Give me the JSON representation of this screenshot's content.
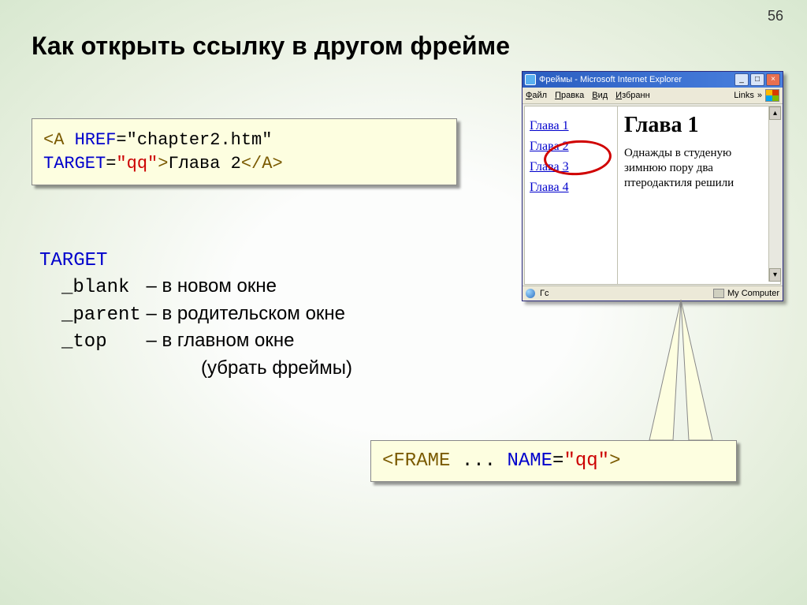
{
  "page_number": "56",
  "title": "Как открыть ссылку в другом фрейме",
  "code1": {
    "lt1": "<",
    "A": "A",
    "sp": " ",
    "HREF": "HREF",
    "eq": "=",
    "href_val": "\"chapter2.htm\"",
    "indent": "    ",
    "TARGET": "TARGET",
    "target_val": "\"qq\"",
    "gt": ">",
    "linktext": "Глава 2",
    "lt2": "</",
    "A2": "A",
    "gt2": ">"
  },
  "targets": {
    "head": "TARGET",
    "rows": [
      {
        "kw": "_blank ",
        "desc": " – в новом окне"
      },
      {
        "kw": "_parent",
        "desc": " – в родительском окне"
      },
      {
        "kw": "_top   ",
        "desc": " – в главном окне"
      }
    ],
    "extra": "(убрать фреймы)"
  },
  "code2": {
    "lt": "<",
    "FRAME": "FRAME",
    "dots": " ... ",
    "NAME": "NAME",
    "eq": "=",
    "name_val": "\"qq\"",
    "gt": ">"
  },
  "browser": {
    "title": "Фреймы - Microsoft Internet Explorer",
    "menu": {
      "file": "Файл",
      "edit": "Правка",
      "view": "Вид",
      "fav": "Избранн",
      "links": "Links"
    },
    "nav_items": [
      "Глава 1",
      "Глава 2",
      "Глава 3",
      "Глава 4"
    ],
    "heading": "Глава 1",
    "paragraph": "Однажды в студеную зимнюю пору два птеродактиля решили",
    "status_left": "Гс",
    "status_right": "My Computer"
  }
}
